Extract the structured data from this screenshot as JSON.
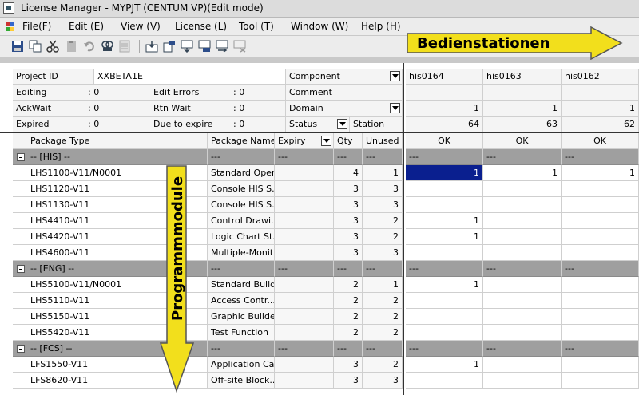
{
  "window": {
    "title": "License Manager - MYPJT (CENTUM VP)(Edit mode)"
  },
  "menu": [
    "File(F)",
    "Edit (E)",
    "View (V)",
    "License (L)",
    "Tool (T)",
    "Window (W)",
    "Help (H)"
  ],
  "toolbar_icons": [
    "save-icon",
    "copy-icon",
    "cut-icon",
    "paste-icon",
    "undo-icon",
    "find-icon",
    "list-icon",
    "import-icon",
    "export-icon",
    "assign-icon",
    "release-icon",
    "transfer-icon",
    "delete-icon"
  ],
  "info": {
    "project_id_label": "Project ID",
    "project_id_value": "XXBETA1E",
    "editing_label": "Editing",
    "editing_value": ": 0",
    "edit_errors_label": "Edit Errors",
    "edit_errors_value": ": 0",
    "ackwait_label": "AckWait",
    "ackwait_value": ": 0",
    "rtn_wait_label": "Rtn Wait",
    "rtn_wait_value": ": 0",
    "expired_label": "Expired",
    "expired_value": ": 0",
    "due_label": "Due to expire",
    "due_value": ": 0",
    "component_label": "Component",
    "comment_label": "Comment",
    "domain_label": "Domain",
    "status_label": "Status",
    "station_label": "Station"
  },
  "columns": {
    "package_type": "Package Type",
    "package_name": "Package Name",
    "expiry": "Expiry",
    "qty": "Qty",
    "unused": "Unused"
  },
  "stations": [
    {
      "name": "his0164",
      "domain": "1",
      "station": "64",
      "status": "OK"
    },
    {
      "name": "his0163",
      "domain": "1",
      "station": "63",
      "status": "OK"
    },
    {
      "name": "his0162",
      "domain": "1",
      "station": "62",
      "status": "OK"
    }
  ],
  "rows": [
    {
      "group": "-- [HIS] --"
    },
    {
      "type": "LHS1100-V11/N0001",
      "name": "Standard Oper...",
      "qty": "4",
      "unused": "1",
      "s": [
        "1",
        "1",
        "1"
      ]
    },
    {
      "type": "LHS1120-V11",
      "name": "Console HIS S...",
      "qty": "3",
      "unused": "3",
      "s": [
        "",
        "",
        ""
      ]
    },
    {
      "type": "LHS1130-V11",
      "name": "Console HIS S...",
      "qty": "3",
      "unused": "3",
      "s": [
        "",
        "",
        ""
      ]
    },
    {
      "type": "LHS4410-V11",
      "name": "Control Drawi...",
      "qty": "3",
      "unused": "2",
      "s": [
        "1",
        "",
        ""
      ]
    },
    {
      "type": "LHS4420-V11",
      "name": "Logic Chart St...",
      "qty": "3",
      "unused": "2",
      "s": [
        "1",
        "",
        ""
      ]
    },
    {
      "type": "LHS4600-V11",
      "name": "Multiple-Monit...",
      "qty": "3",
      "unused": "3",
      "s": [
        "",
        "",
        ""
      ]
    },
    {
      "group": "-- [ENG] --"
    },
    {
      "type": "LHS5100-V11/N0001",
      "name": "Standard Build...",
      "qty": "2",
      "unused": "1",
      "s": [
        "1",
        "",
        ""
      ]
    },
    {
      "type": "LHS5110-V11",
      "name": "Access Contr...",
      "qty": "2",
      "unused": "2",
      "s": [
        "",
        "",
        ""
      ]
    },
    {
      "type": "LHS5150-V11",
      "name": "Graphic Builder",
      "qty": "2",
      "unused": "2",
      "s": [
        "",
        "",
        ""
      ]
    },
    {
      "type": "LHS5420-V11",
      "name": "Test Function",
      "qty": "2",
      "unused": "2",
      "s": [
        "",
        "",
        ""
      ]
    },
    {
      "group": "-- [FCS] --"
    },
    {
      "type": "LFS1550-V11",
      "name": "Application Ca...",
      "qty": "3",
      "unused": "2",
      "s": [
        "1",
        "",
        ""
      ]
    },
    {
      "type": "LFS8620-V11",
      "name": "Off-site Block...",
      "qty": "3",
      "unused": "3",
      "s": [
        "",
        "",
        ""
      ]
    }
  ],
  "group_filler": "---",
  "annotations": {
    "horizontal": "Bedienstationen",
    "vertical": "Programmmodule"
  },
  "colors": {
    "arrow_fill": "#f2df1c",
    "selection": "#0a1f8f",
    "group_bg": "#9f9f9f"
  }
}
